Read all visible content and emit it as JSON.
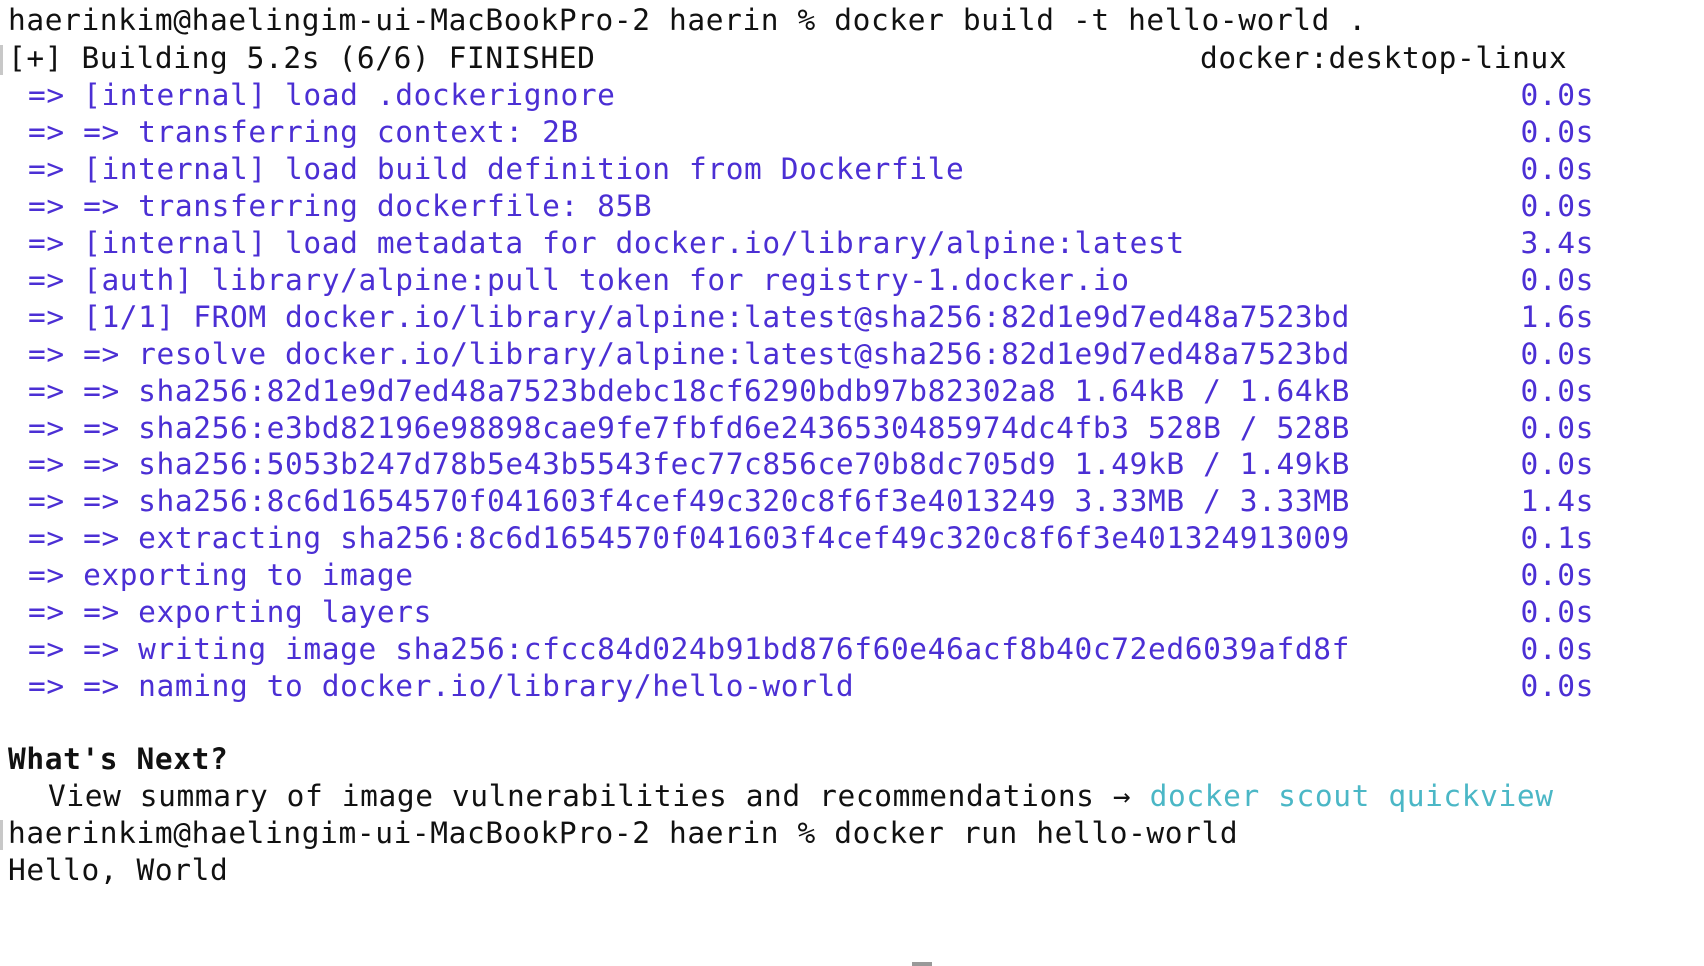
{
  "prompt": {
    "user_host": "haerinkim@haelingim-ui-MacBookPro-2",
    "dir": "haerin",
    "symbol": "%"
  },
  "commands": {
    "build": "docker build -t hello-world .",
    "run": "docker run hello-world"
  },
  "build_status": {
    "text": "[+] Building 5.2s (6/6) FINISHED",
    "context": "docker:desktop-linux"
  },
  "steps": [
    {
      "text": "=> [internal] load .dockerignore",
      "time": "0.0s"
    },
    {
      "text": "=> => transferring context: 2B",
      "time": "0.0s"
    },
    {
      "text": "=> [internal] load build definition from Dockerfile",
      "time": "0.0s"
    },
    {
      "text": "=> => transferring dockerfile: 85B",
      "time": "0.0s"
    },
    {
      "text": "=> [internal] load metadata for docker.io/library/alpine:latest",
      "time": "3.4s"
    },
    {
      "text": "=> [auth] library/alpine:pull token for registry-1.docker.io",
      "time": "0.0s"
    },
    {
      "text": "=> [1/1] FROM docker.io/library/alpine:latest@sha256:82d1e9d7ed48a7523bd",
      "time": "1.6s"
    },
    {
      "text": "=> => resolve docker.io/library/alpine:latest@sha256:82d1e9d7ed48a7523bd",
      "time": "0.0s"
    },
    {
      "text": "=> => sha256:82d1e9d7ed48a7523bdebc18cf6290bdb97b82302a8 1.64kB / 1.64kB",
      "time": "0.0s"
    },
    {
      "text": "=> => sha256:e3bd82196e98898cae9fe7fbfd6e2436530485974dc4fb3 528B / 528B",
      "time": "0.0s"
    },
    {
      "text": "=> => sha256:5053b247d78b5e43b5543fec77c856ce70b8dc705d9 1.49kB / 1.49kB",
      "time": "0.0s"
    },
    {
      "text": "=> => sha256:8c6d1654570f041603f4cef49c320c8f6f3e4013249 3.33MB / 3.33MB",
      "time": "1.4s"
    },
    {
      "text": "=> => extracting sha256:8c6d1654570f041603f4cef49c320c8f6f3e401324913009",
      "time": "0.1s"
    },
    {
      "text": "=> exporting to image",
      "time": "0.0s"
    },
    {
      "text": "=> => exporting layers",
      "time": "0.0s"
    },
    {
      "text": "=> => writing image sha256:cfcc84d024b91bd876f60e46acf8b40c72ed6039afd8f",
      "time": "0.0s"
    },
    {
      "text": "=> => naming to docker.io/library/hello-world",
      "time": "0.0s"
    }
  ],
  "whats_next": {
    "title": "What's Next?",
    "text": "View summary of image vulnerabilities and recommendations →",
    "link": "docker scout quickview"
  },
  "output": {
    "hello": "Hello, World"
  },
  "colors": {
    "step_text": "#4b2fd4",
    "link": "#4bb7c6",
    "text": "#111111",
    "background": "#ffffff"
  }
}
